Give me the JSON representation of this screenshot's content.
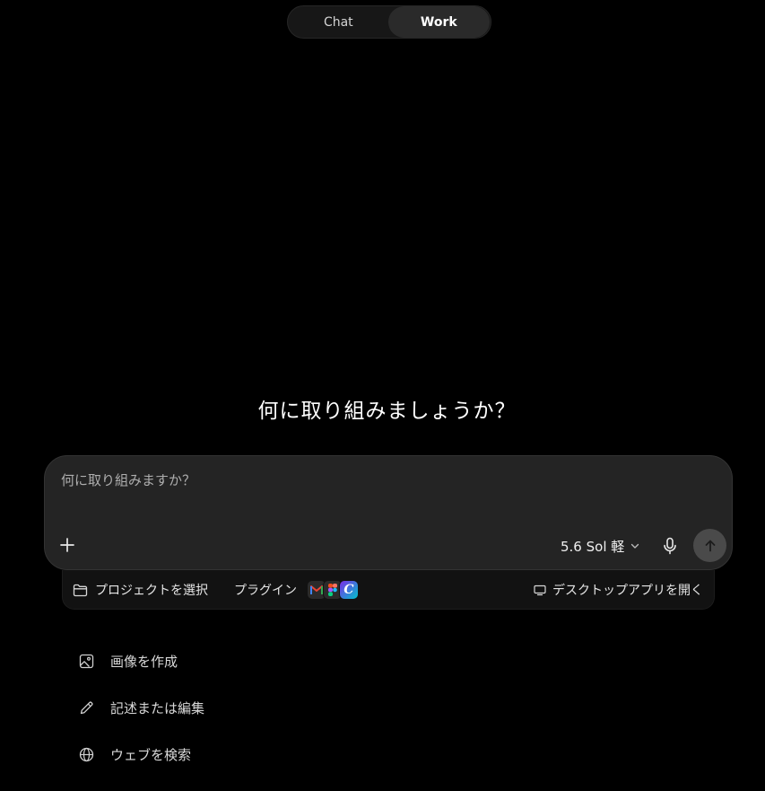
{
  "mode_toggle": {
    "tabs": [
      {
        "label": "Chat",
        "active": false
      },
      {
        "label": "Work",
        "active": true
      }
    ]
  },
  "main": {
    "title": "何に取り組みましょうか？"
  },
  "composer": {
    "placeholder": "何に取り組みますか？",
    "model_label": "5.6 Sol 軽"
  },
  "sub_bar": {
    "project_label": "プロジェクトを選択",
    "plugins_label": "プラグイン",
    "plugin_icons": [
      {
        "letter": "M",
        "bg": "#2b2b2b"
      },
      {
        "letter": "F",
        "bg": "#2b2b2b"
      },
      {
        "letter": "C",
        "bg": "#3a3ad6"
      }
    ],
    "desktop_label": "デスクトップアプリを開く"
  },
  "suggestions": [
    {
      "label": "画像を作成",
      "icon": "image-icon"
    },
    {
      "label": "記述または編集",
      "icon": "pencil-icon"
    },
    {
      "label": "ウェブを検索",
      "icon": "globe-icon"
    }
  ],
  "colors": {
    "background": "#000000",
    "composer": "#242424",
    "send_button": "#4a4a4a"
  }
}
